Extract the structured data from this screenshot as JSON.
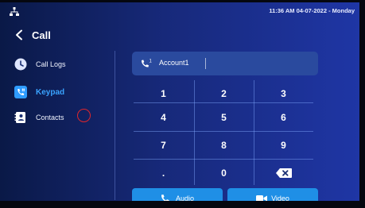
{
  "status": {
    "time_date": "11:36 AM 04-07-2022 - Monday"
  },
  "header": {
    "title": "Call"
  },
  "sidebar": {
    "items": [
      {
        "label": "Call Logs",
        "icon": "clock-icon"
      },
      {
        "label": "Keypad",
        "icon": "phone-keypad-icon",
        "active": true
      },
      {
        "label": "Contacts",
        "icon": "contacts-book-icon"
      }
    ]
  },
  "account": {
    "name": "Account1",
    "line": "1"
  },
  "keypad": {
    "keys": [
      "1",
      "2",
      "3",
      "4",
      "5",
      "6",
      "7",
      "8",
      "9",
      ".",
      "0"
    ],
    "backspace_icon": "backspace-icon"
  },
  "actions": {
    "audio_label": "Audio",
    "video_label": "Video"
  },
  "colors": {
    "accent": "#3aa3ff",
    "button": "#1f8fe6",
    "annotation": "#e0262b"
  }
}
